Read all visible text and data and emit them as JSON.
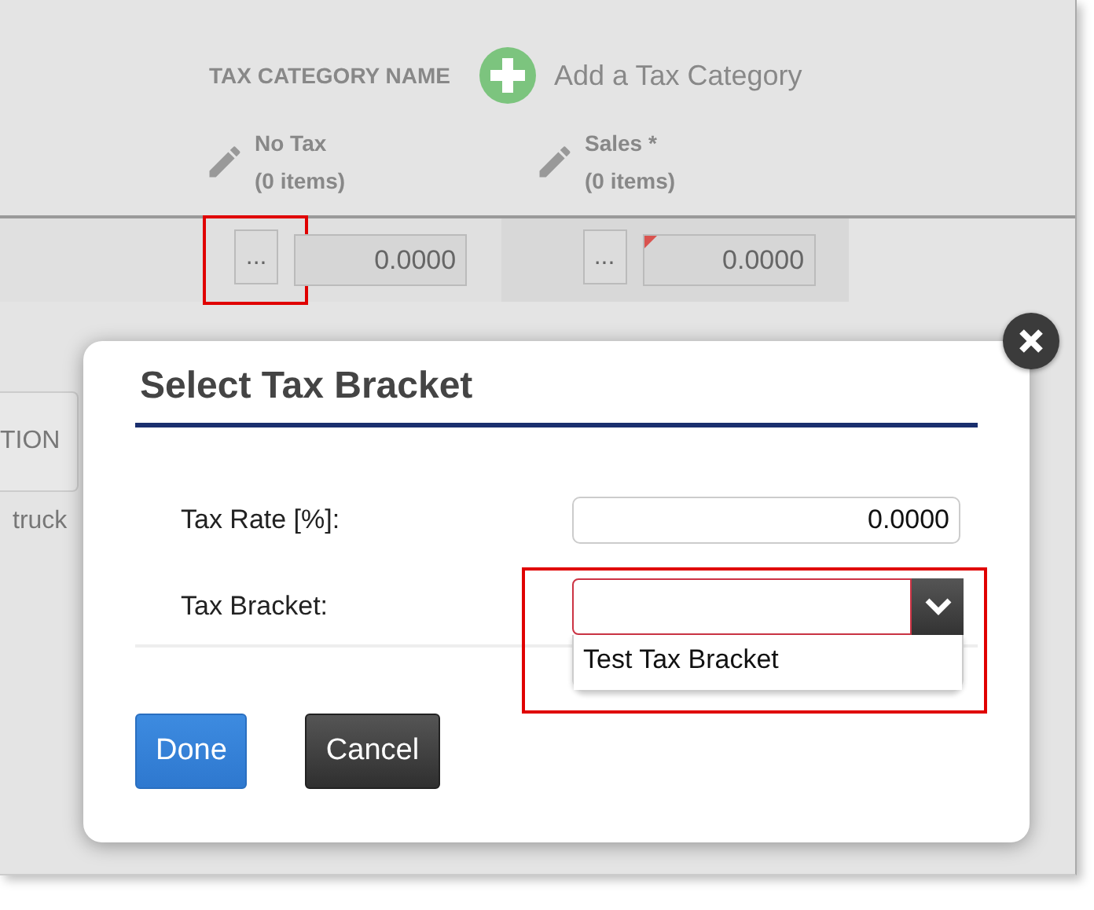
{
  "page": {
    "column_header": "TAX CATEGORY NAME",
    "add_link": "Add a Tax Category",
    "categories": [
      {
        "name": "No Tax",
        "count": "(0 items)",
        "button": "...",
        "value": "0.0000",
        "flagged": false,
        "highlighted": true
      },
      {
        "name": "Sales *",
        "count": "(0 items)",
        "button": "...",
        "value": "0.0000",
        "flagged": true,
        "highlighted": false
      }
    ],
    "side_tab": "TION",
    "side_text": "truck"
  },
  "dialog": {
    "title": "Select Tax Bracket",
    "fields": [
      {
        "kind": "input",
        "label": "Tax Rate [%]:",
        "value": "0.0000"
      },
      {
        "kind": "select",
        "label": "Tax Bracket:",
        "invalid": true,
        "highlighted": true,
        "options": [
          {
            "label": "Test Tax Bracket",
            "selected": false
          }
        ]
      }
    ],
    "buttons": [
      {
        "label": "Done",
        "kind": "primary"
      },
      {
        "label": "Cancel",
        "kind": "secondary"
      }
    ]
  }
}
